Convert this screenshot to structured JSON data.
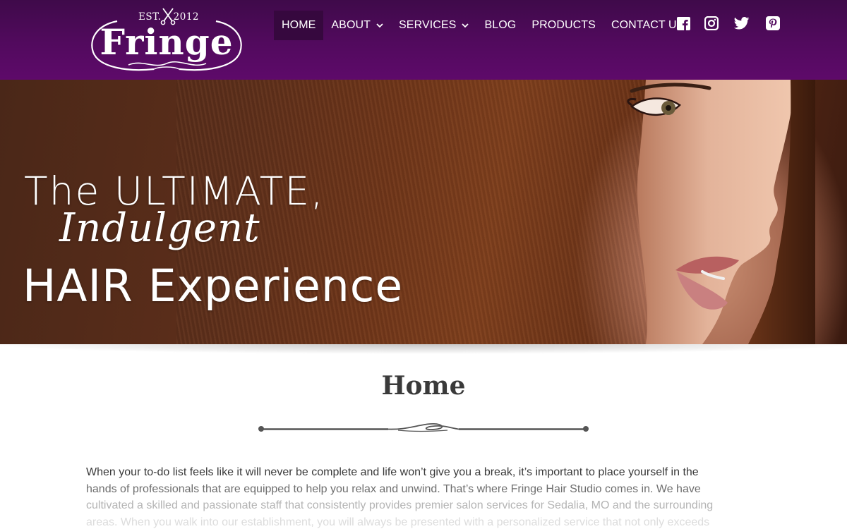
{
  "brand": {
    "est_label": "EST.",
    "year": "2012",
    "name": "Fringe"
  },
  "nav": {
    "items": [
      {
        "label": "HOME",
        "active": true
      },
      {
        "label": "ABOUT",
        "dropdown": true
      },
      {
        "label": "SERVICES",
        "dropdown": true
      },
      {
        "label": "BLOG"
      },
      {
        "label": "PRODUCTS"
      },
      {
        "label": "CONTACT US"
      }
    ],
    "social": [
      "facebook-icon",
      "instagram-icon",
      "twitter-icon",
      "pinterest-icon"
    ]
  },
  "hero": {
    "line1": "The ULTIMATE,",
    "line2": "Indulgent",
    "line3": "HAIR Experience"
  },
  "page": {
    "title": "Home",
    "intro_line1": "When your to-do list feels like it will never be complete and life won’t give you a break, it’s important to place yourself in the",
    "intro_line2": "hands of professionals that are equipped to help you relax and unwind. That’s where Fringe Hair Studio comes in. We have",
    "intro_line3": "cultivated a skilled and passionate staff that consistently provides premier salon services for Sedalia, MO and the surrounding",
    "intro_line4": "areas. When you walk into our establishment, you will always be presented with a personalized service that not only exceeds"
  },
  "colors": {
    "header_purple": "#520a5e",
    "active_nav": "#36083e",
    "text_dark": "#3a3a3a"
  }
}
